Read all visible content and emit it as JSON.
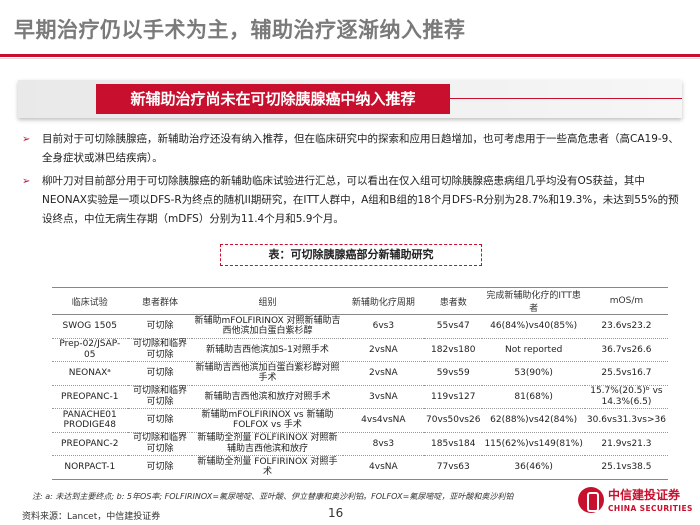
{
  "header": {
    "title": "早期治疗仍以手术为主，辅助治疗逐渐纳入推荐"
  },
  "section": {
    "banner": "新辅助治疗尚未在可切除胰腺癌中纳入推荐"
  },
  "bullets": [
    "目前对于可切除胰腺癌，新辅助治疗还没有纳入推荐，但在临床研究中的探索和应用日趋增加，也可考虑用于一些高危患者（高CA19-9、全身症状或淋巴结疾病）。",
    "柳叶刀对目前部分用于可切除胰腺癌的新辅助临床试验进行汇总，可以看出在仅入组可切除胰腺癌患病组几乎均没有OS获益，其中NEONAX实验是一项以DFS-R为终点的随机II期研究，在ITT人群中，A组和B组的18个月DFS-R分别为28.7%和19.3%，未达到55%的预设终点，中位无病生存期（mDFS）分别为11.4个月和5.9个月。"
  ],
  "table": {
    "caption": "表：可切除胰腺癌部分新辅助研究",
    "headers": [
      "临床试验",
      "患者群体",
      "组别",
      "新辅助化疗周期",
      "患者数",
      "完成新辅助化疗的ITT患者",
      "mOS/m"
    ],
    "rows": [
      [
        "SWOG 1505",
        "可切除",
        "新辅助mFOLFIRINOX 对照新辅助吉西他滨加白蛋白紫杉醇",
        "6vs3",
        "55vs47",
        "46(84%)vs40(85%)",
        "23.6vs23.2"
      ],
      [
        "Prep-02/JSAP-05",
        "可切除和临界可切除",
        "新辅助吉西他滨加S-1对照手术",
        "2vsNA",
        "182vs180",
        "Not reported",
        "36.7vs26.6"
      ],
      [
        "NEONAXᵃ",
        "可切除",
        "新辅助吉西他滨加白蛋白紫杉醇对照手术",
        "2vsNA",
        "59vs59",
        "53(90%)",
        "25.5vs16.7"
      ],
      [
        "PREOPANC-1",
        "可切除和临界可切除",
        "新辅助吉西他滨和放疗对照手术",
        "3vsNA",
        "119vs127",
        "81(68%)",
        "15.7%(20.5)ᵇ vs 14.3%(6.5)"
      ],
      [
        "PANACHE01 PRODIGE48",
        "可切除",
        "新辅助mFOLFIRINOX vs 新辅助FOLFOX vs 手术",
        "4vs4vsNA",
        "70vs50vs26",
        "62(88%)vs42(84%)",
        "30.6vs31.3vs>36"
      ],
      [
        "PREOPANC-2",
        "可切除和临界可切除",
        "新辅助全剂量 FOLFIRINOX 对照新辅助吉西他滨和放疗",
        "8vs3",
        "185vs184",
        "115(62%)vs149(81%)",
        "21.9vs21.3"
      ],
      [
        "NORPACT-1",
        "可切除",
        "新辅助全剂量 FOLFIRINOX 对照手术",
        "4vsNA",
        "77vs63",
        "36(46%)",
        "25.1vs38.5"
      ]
    ],
    "note": "注: a: 未达到主要终点; b: 5年OS率; FOLFIRINOX=氟尿嘧啶、亚叶酸、伊立替康和奥沙利铂。FOLFOX=氟尿嘧啶，亚叶酸和奥沙利铂"
  },
  "footer": {
    "source": "资料来源：Lancet，中信建投证券",
    "page": "16",
    "logo_cn": "中信建投证券",
    "logo_en": "CHINA SECURITIES"
  },
  "colors": {
    "accent": "#c8102e",
    "title_gray": "#7a7a7a"
  }
}
